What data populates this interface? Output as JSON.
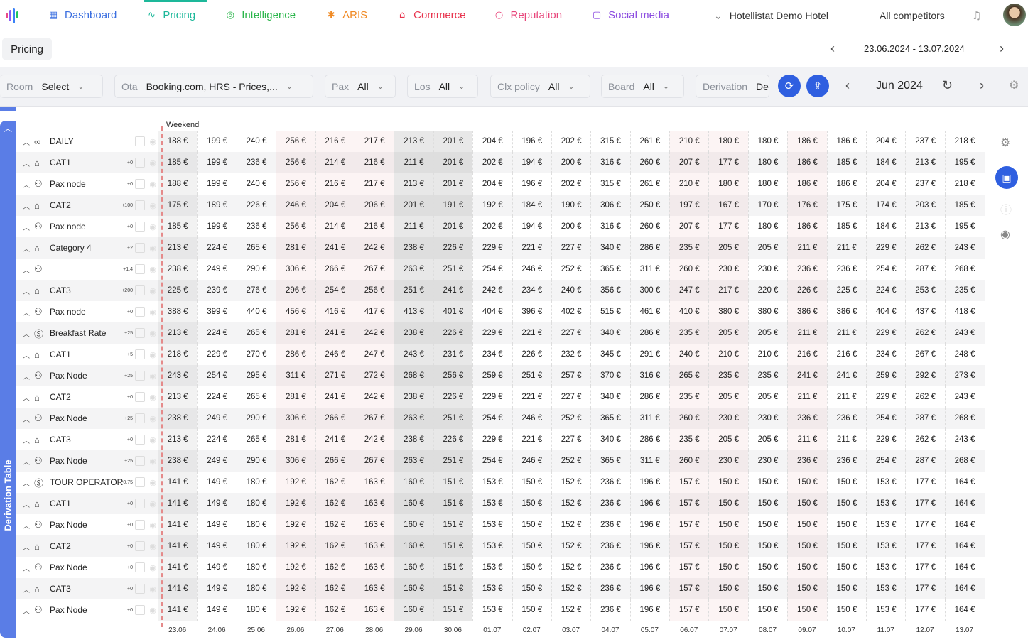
{
  "nav": {
    "items": [
      {
        "label": "Dashboard",
        "icon": "grid-icon",
        "color": "#3b6fe0"
      },
      {
        "label": "Pricing",
        "icon": "chart-line-icon",
        "color": "#1db89a"
      },
      {
        "label": "Intelligence",
        "icon": "brain-icon",
        "color": "#2ab54a"
      },
      {
        "label": "ARIS",
        "icon": "atom-icon",
        "color": "#f08a24"
      },
      {
        "label": "Commerce",
        "icon": "bank-icon",
        "color": "#e8344e"
      },
      {
        "label": "Reputation",
        "icon": "chat-icon",
        "color": "#e8447a"
      },
      {
        "label": "Social media",
        "icon": "instagram-icon",
        "color": "#8b4be0"
      }
    ],
    "hotel": "Hotellistat Demo Hotel",
    "competitors": "All competitors"
  },
  "subheader": {
    "tab": "Pricing",
    "date_range": "23.06.2024 - 13.07.2024"
  },
  "filters": [
    {
      "label": "Room",
      "value": "Select"
    },
    {
      "label": "Ota",
      "value": "Booking.com, HRS - Prices,..."
    },
    {
      "label": "Pax",
      "value": "All"
    },
    {
      "label": "Los",
      "value": "All"
    },
    {
      "label": "Clx policy",
      "value": "All"
    },
    {
      "label": "Board",
      "value": "All"
    },
    {
      "label": "Derivation",
      "value": "De"
    }
  ],
  "month": "Jun 2024",
  "sidebar_title": "Derivation Table",
  "weekend_label": "Weekend",
  "currency": "€",
  "dates": [
    "23.06",
    "24.06",
    "25.06",
    "26.06",
    "27.06",
    "28.06",
    "29.06",
    "30.06",
    "01.07",
    "02.07",
    "03.07",
    "04.07",
    "05.07",
    "06.07",
    "07.07",
    "08.07",
    "09.07",
    "10.07",
    "11.07",
    "12.07",
    "13.07"
  ],
  "col_shade": [
    "g",
    "",
    "",
    "p",
    "p",
    "p",
    "d",
    "d",
    "",
    "",
    "",
    "",
    "",
    "p",
    "p",
    "",
    "p",
    "",
    "",
    "",
    ""
  ],
  "rows": [
    {
      "name": "DAILY",
      "icon": "link",
      "mod": "",
      "values": [
        188,
        199,
        240,
        256,
        216,
        217,
        213,
        201,
        204,
        196,
        202,
        315,
        261,
        210,
        180,
        180,
        186,
        186,
        204,
        237,
        218
      ]
    },
    {
      "name": "CAT1",
      "icon": "home",
      "mod": "+0",
      "values": [
        185,
        199,
        236,
        256,
        214,
        216,
        211,
        201,
        202,
        194,
        200,
        316,
        260,
        207,
        177,
        180,
        186,
        185,
        184,
        213,
        195
      ]
    },
    {
      "name": "Pax node",
      "icon": "user",
      "mod": "+0",
      "values": [
        188,
        199,
        240,
        256,
        216,
        217,
        213,
        201,
        204,
        196,
        202,
        315,
        261,
        210,
        180,
        180,
        186,
        186,
        204,
        237,
        218
      ]
    },
    {
      "name": "CAT2",
      "icon": "home",
      "mod": "+100",
      "values": [
        175,
        189,
        226,
        246,
        204,
        206,
        201,
        191,
        192,
        184,
        190,
        306,
        250,
        197,
        167,
        170,
        176,
        175,
        174,
        203,
        185
      ]
    },
    {
      "name": "Pax node",
      "icon": "user",
      "mod": "+0",
      "values": [
        185,
        199,
        236,
        256,
        214,
        216,
        211,
        201,
        202,
        194,
        200,
        316,
        260,
        207,
        177,
        180,
        186,
        185,
        184,
        213,
        195
      ]
    },
    {
      "name": "Category 4",
      "icon": "home",
      "mod": "+2",
      "values": [
        213,
        224,
        265,
        281,
        241,
        242,
        238,
        226,
        229,
        221,
        227,
        340,
        286,
        235,
        205,
        205,
        211,
        211,
        229,
        262,
        243
      ]
    },
    {
      "name": "",
      "icon": "user",
      "mod": "+1.4",
      "values": [
        238,
        249,
        290,
        306,
        266,
        267,
        263,
        251,
        254,
        246,
        252,
        365,
        311,
        260,
        230,
        230,
        236,
        236,
        254,
        287,
        268
      ]
    },
    {
      "name": "CAT3",
      "icon": "home",
      "mod": "+200",
      "values": [
        225,
        239,
        276,
        296,
        254,
        256,
        251,
        241,
        242,
        234,
        240,
        356,
        300,
        247,
        217,
        220,
        226,
        225,
        224,
        253,
        235
      ]
    },
    {
      "name": "Pax node",
      "icon": "user",
      "mod": "+0",
      "values": [
        388,
        399,
        440,
        456,
        416,
        417,
        413,
        401,
        404,
        396,
        402,
        515,
        461,
        410,
        380,
        380,
        386,
        386,
        404,
        437,
        418
      ]
    },
    {
      "name": "Breakfast Rate",
      "icon": "dollar",
      "mod": "+25",
      "values": [
        213,
        224,
        265,
        281,
        241,
        242,
        238,
        226,
        229,
        221,
        227,
        340,
        286,
        235,
        205,
        205,
        211,
        211,
        229,
        262,
        243
      ]
    },
    {
      "name": "CAT1",
      "icon": "home",
      "mod": "+5",
      "values": [
        218,
        229,
        270,
        286,
        246,
        247,
        243,
        231,
        234,
        226,
        232,
        345,
        291,
        240,
        210,
        210,
        216,
        216,
        234,
        267,
        248
      ]
    },
    {
      "name": "Pax Node",
      "icon": "user",
      "mod": "+25",
      "values": [
        243,
        254,
        295,
        311,
        271,
        272,
        268,
        256,
        259,
        251,
        257,
        370,
        316,
        265,
        235,
        235,
        241,
        241,
        259,
        292,
        273
      ]
    },
    {
      "name": "CAT2",
      "icon": "home",
      "mod": "+0",
      "values": [
        213,
        224,
        265,
        281,
        241,
        242,
        238,
        226,
        229,
        221,
        227,
        340,
        286,
        235,
        205,
        205,
        211,
        211,
        229,
        262,
        243
      ]
    },
    {
      "name": "Pax Node",
      "icon": "user",
      "mod": "+25",
      "values": [
        238,
        249,
        290,
        306,
        266,
        267,
        263,
        251,
        254,
        246,
        252,
        365,
        311,
        260,
        230,
        230,
        236,
        236,
        254,
        287,
        268
      ]
    },
    {
      "name": "CAT3",
      "icon": "home",
      "mod": "+0",
      "values": [
        213,
        224,
        265,
        281,
        241,
        242,
        238,
        226,
        229,
        221,
        227,
        340,
        286,
        235,
        205,
        205,
        211,
        211,
        229,
        262,
        243
      ]
    },
    {
      "name": "Pax Node",
      "icon": "user",
      "mod": "+25",
      "values": [
        238,
        249,
        290,
        306,
        266,
        267,
        263,
        251,
        254,
        246,
        252,
        365,
        311,
        260,
        230,
        230,
        236,
        236,
        254,
        287,
        268
      ]
    },
    {
      "name": "TOUR OPERATOR",
      "icon": "dollar",
      "mod": "*0.75",
      "values": [
        141,
        149,
        180,
        192,
        162,
        163,
        160,
        151,
        153,
        150,
        152,
        236,
        196,
        157,
        150,
        150,
        150,
        150,
        153,
        177,
        164
      ]
    },
    {
      "name": "CAT1",
      "icon": "home",
      "mod": "+0",
      "values": [
        141,
        149,
        180,
        192,
        162,
        163,
        160,
        151,
        153,
        150,
        152,
        236,
        196,
        157,
        150,
        150,
        150,
        150,
        153,
        177,
        164
      ]
    },
    {
      "name": "Pax Node",
      "icon": "user",
      "mod": "+0",
      "values": [
        141,
        149,
        180,
        192,
        162,
        163,
        160,
        151,
        153,
        150,
        152,
        236,
        196,
        157,
        150,
        150,
        150,
        150,
        153,
        177,
        164
      ]
    },
    {
      "name": "CAT2",
      "icon": "home",
      "mod": "+0",
      "values": [
        141,
        149,
        180,
        192,
        162,
        163,
        160,
        151,
        153,
        150,
        152,
        236,
        196,
        157,
        150,
        150,
        150,
        150,
        153,
        177,
        164
      ]
    },
    {
      "name": "Pax Node",
      "icon": "user",
      "mod": "+0",
      "values": [
        141,
        149,
        180,
        192,
        162,
        163,
        160,
        151,
        153,
        150,
        152,
        236,
        196,
        157,
        150,
        150,
        150,
        150,
        153,
        177,
        164
      ]
    },
    {
      "name": "CAT3",
      "icon": "home",
      "mod": "+0",
      "values": [
        141,
        149,
        180,
        192,
        162,
        163,
        160,
        151,
        153,
        150,
        152,
        236,
        196,
        157,
        150,
        150,
        150,
        150,
        153,
        177,
        164
      ]
    },
    {
      "name": "Pax Node",
      "icon": "user",
      "mod": "+0",
      "values": [
        141,
        149,
        180,
        192,
        162,
        163,
        160,
        151,
        153,
        150,
        152,
        236,
        196,
        157,
        150,
        150,
        150,
        150,
        153,
        177,
        164
      ]
    }
  ]
}
